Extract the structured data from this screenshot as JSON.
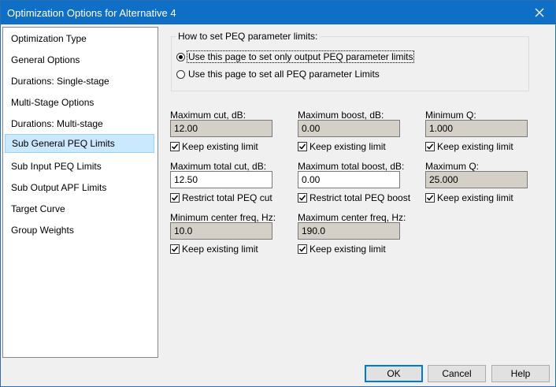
{
  "window": {
    "title": "Optimization Options for Alternative 4"
  },
  "sidebar": {
    "items": [
      {
        "label": "Optimization Type"
      },
      {
        "label": "General Options"
      },
      {
        "label": "Durations: Single-stage"
      },
      {
        "label": "Multi-Stage Options"
      },
      {
        "label": "Durations: Multi-stage"
      },
      {
        "label": "Sub General PEQ Limits",
        "selected": true
      },
      {
        "label": "Sub Input PEQ Limits"
      },
      {
        "label": "Sub Output APF Limits"
      },
      {
        "label": "Target Curve"
      },
      {
        "label": "Group Weights"
      }
    ]
  },
  "peq_mode": {
    "title": "How to set PEQ parameter limits:",
    "option_output": "Use this page to set only output PEQ parameter limits",
    "option_all": "Use this page to set all PEQ parameter Limits",
    "selected": "output"
  },
  "limits": {
    "max_cut_label": "Maximum cut, dB:",
    "max_cut_value": "12.00",
    "max_boost_label": "Maximum boost, dB:",
    "max_boost_value": "0.00",
    "min_q_label": "Minimum Q:",
    "min_q_value": "1.000",
    "keep_label": "Keep existing limit",
    "max_total_cut_label": "Maximum total cut, dB:",
    "max_total_cut_value": "12.50",
    "max_total_boost_label": "Maximum total boost, dB:",
    "max_total_boost_value": "0.00",
    "max_q_label": "Maximum Q:",
    "max_q_value": "25.000",
    "restrict_cut_label": "Restrict total PEQ cut",
    "restrict_boost_label": "Restrict total PEQ boost",
    "min_freq_label": "Minimum center freq, Hz:",
    "min_freq_value": "10.0",
    "max_freq_label": "Maximum center freq, Hz:",
    "max_freq_value": "190.0"
  },
  "buttons": {
    "ok": "OK",
    "cancel": "Cancel",
    "help": "Help"
  },
  "colors": {
    "titlebar": "#0f6fc6",
    "selection": "#cce8ff"
  }
}
